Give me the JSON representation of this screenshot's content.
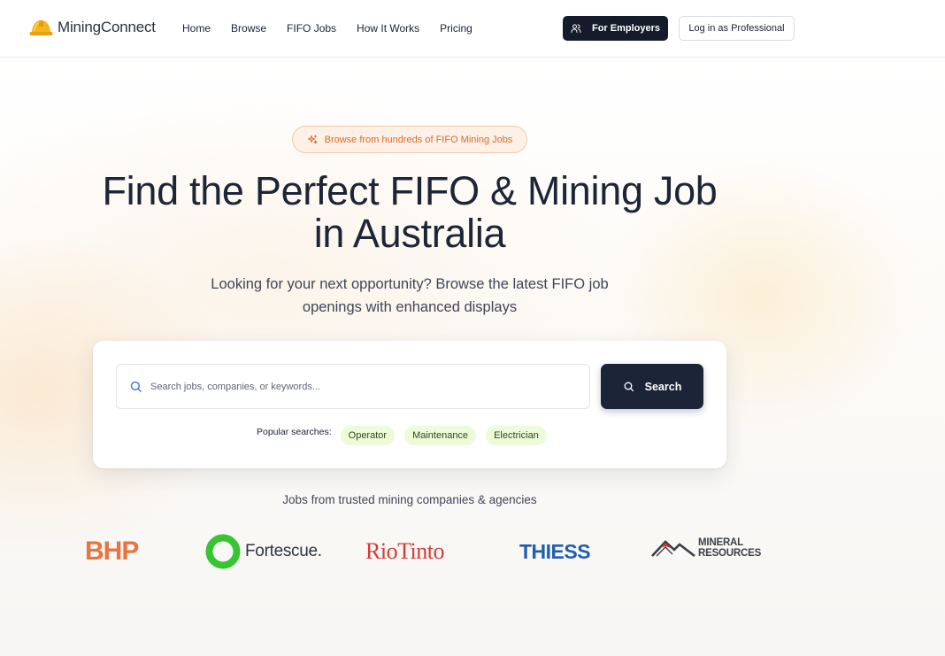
{
  "brand": {
    "name": "MiningConnect",
    "icon": "hard-hat-icon",
    "accent": "#f5b61a"
  },
  "nav": {
    "items": [
      {
        "label": "Home"
      },
      {
        "label": "Browse"
      },
      {
        "label": "FIFO Jobs"
      },
      {
        "label": "How It Works"
      },
      {
        "label": "Pricing"
      }
    ],
    "employers_button": "For Employers",
    "employers_icon": "users-icon",
    "login_button": "Log in as Professional"
  },
  "hero": {
    "badge": "Browse from hundreds of FIFO Mining Jobs",
    "badge_icon": "sparkles-icon",
    "title": "Find the Perfect FIFO & Mining Job in Australia",
    "subtitle": "Looking for your next opportunity? Browse the latest FIFO job openings with enhanced displays"
  },
  "search": {
    "placeholder": "Search jobs, companies, or keywords...",
    "value": "",
    "button_label": "Search",
    "popular_label": "Popular searches:",
    "popular": [
      "Operator",
      "Maintenance",
      "Electrician"
    ]
  },
  "companies": {
    "heading": "Jobs from trusted mining companies & agencies",
    "logos": [
      "BHP",
      "Fortescue.",
      "RioTinto",
      "THIESS",
      "MINERAL",
      "RESOURCES"
    ]
  },
  "colors": {
    "primary_dark": "#141c2b",
    "badge_orange": "#e06a24",
    "chip_green": "#eefbd9",
    "bhp": "#e87440",
    "fortescue": "#37c531",
    "riotinto": "#d33b35",
    "thiess": "#1f5fae"
  }
}
